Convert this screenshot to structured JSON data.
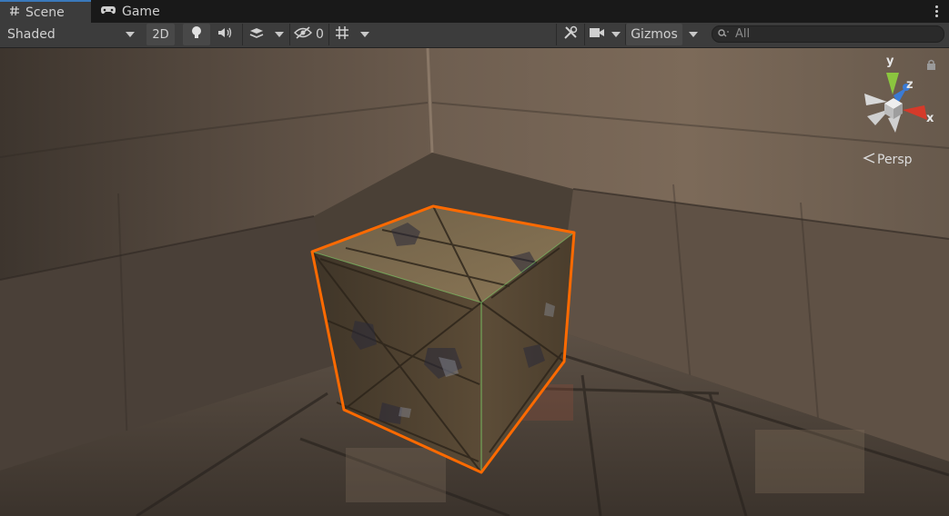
{
  "tabs": [
    {
      "label": "Scene",
      "icon": "hash-icon",
      "active": true
    },
    {
      "label": "Game",
      "icon": "gamepad-icon",
      "active": false
    }
  ],
  "toolbar": {
    "shading_mode": "Shaded",
    "mode_2d_label": "2D",
    "hidden_count": "0",
    "gizmos_label": "Gizmos",
    "search_placeholder": "All"
  },
  "scene_gizmo": {
    "x_label": "x",
    "y_label": "y",
    "z_label": "z",
    "projection_label": "Persp",
    "colors": {
      "x": "#d53a2a",
      "y": "#8bc53f",
      "z": "#3a7bd5"
    }
  },
  "selection_outline_color": "#ff6a00"
}
